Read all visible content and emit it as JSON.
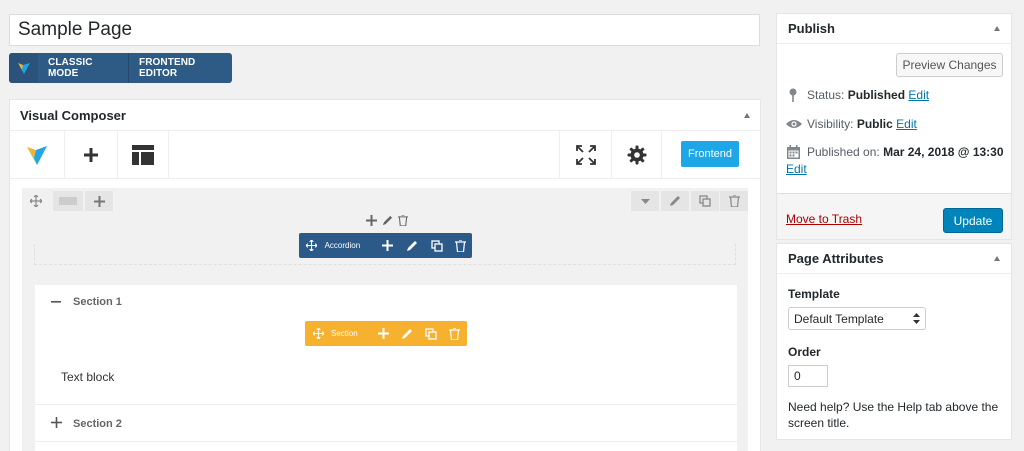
{
  "title": {
    "value": "Sample Page"
  },
  "mode_bar": {
    "classic": "CLASSIC MODE",
    "frontend": "FRONTEND EDITOR"
  },
  "vc": {
    "header": "Visual Composer",
    "frontend_button": "Frontend",
    "accordion_label": "Accordion",
    "section_label": "Section",
    "sections": [
      {
        "title": "Section 1",
        "expanded": true,
        "content": "Text block"
      },
      {
        "title": "Section 2",
        "expanded": false
      }
    ]
  },
  "publish": {
    "title": "Publish",
    "preview_button": "Preview Changes",
    "status_label": "Status:",
    "status_value": "Published",
    "status_edit": "Edit",
    "visibility_label": "Visibility:",
    "visibility_value": "Public",
    "visibility_edit": "Edit",
    "published_label": "Published on:",
    "published_value": "Mar 24, 2018 @ 13:30",
    "published_edit": "Edit",
    "trash_link": "Move to Trash",
    "update_button": "Update"
  },
  "page_attributes": {
    "title": "Page Attributes",
    "template_label": "Template",
    "template_value": "Default Template",
    "order_label": "Order",
    "order_value": "0",
    "help_text": "Need help? Use the Help tab above the screen title."
  },
  "colors": {
    "accordion_bar": "#2b5a88",
    "section_bar": "#f6b12e",
    "frontend_button": "#1fa6e7",
    "update_button": "#0085ba",
    "mode_bar": "#2e5a86"
  }
}
